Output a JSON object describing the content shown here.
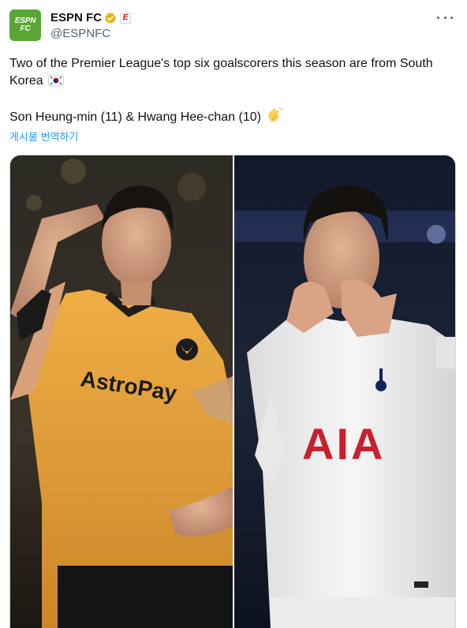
{
  "account": {
    "display_name": "ESPN FC",
    "handle": "@ESPNFC",
    "avatar_text_line1": "ESPN",
    "avatar_text_line2": "FC",
    "affiliate_badge_text": "E",
    "verified_icon": "verified-gold-badge-icon",
    "more_icon": "more-dots-icon"
  },
  "tweet": {
    "line1": "Two of the Premier League's top six goalscorers this season are from South Korea",
    "line2": "Son Heung-min (11) & Hwang Hee-chan (10)",
    "flag_emoji_icon": "south-korea-flag-icon",
    "clap_emoji_icon": "clapping-hands-icon",
    "translate_link": "게시물 번역하기"
  },
  "media": {
    "left_shirt_sponsor": "AstroPay",
    "right_shirt_sponsor": "AIA",
    "left_kit_color": "#e8a43a",
    "right_kit_color": "#f1f1f1",
    "right_sponsor_color": "#c8202f"
  }
}
